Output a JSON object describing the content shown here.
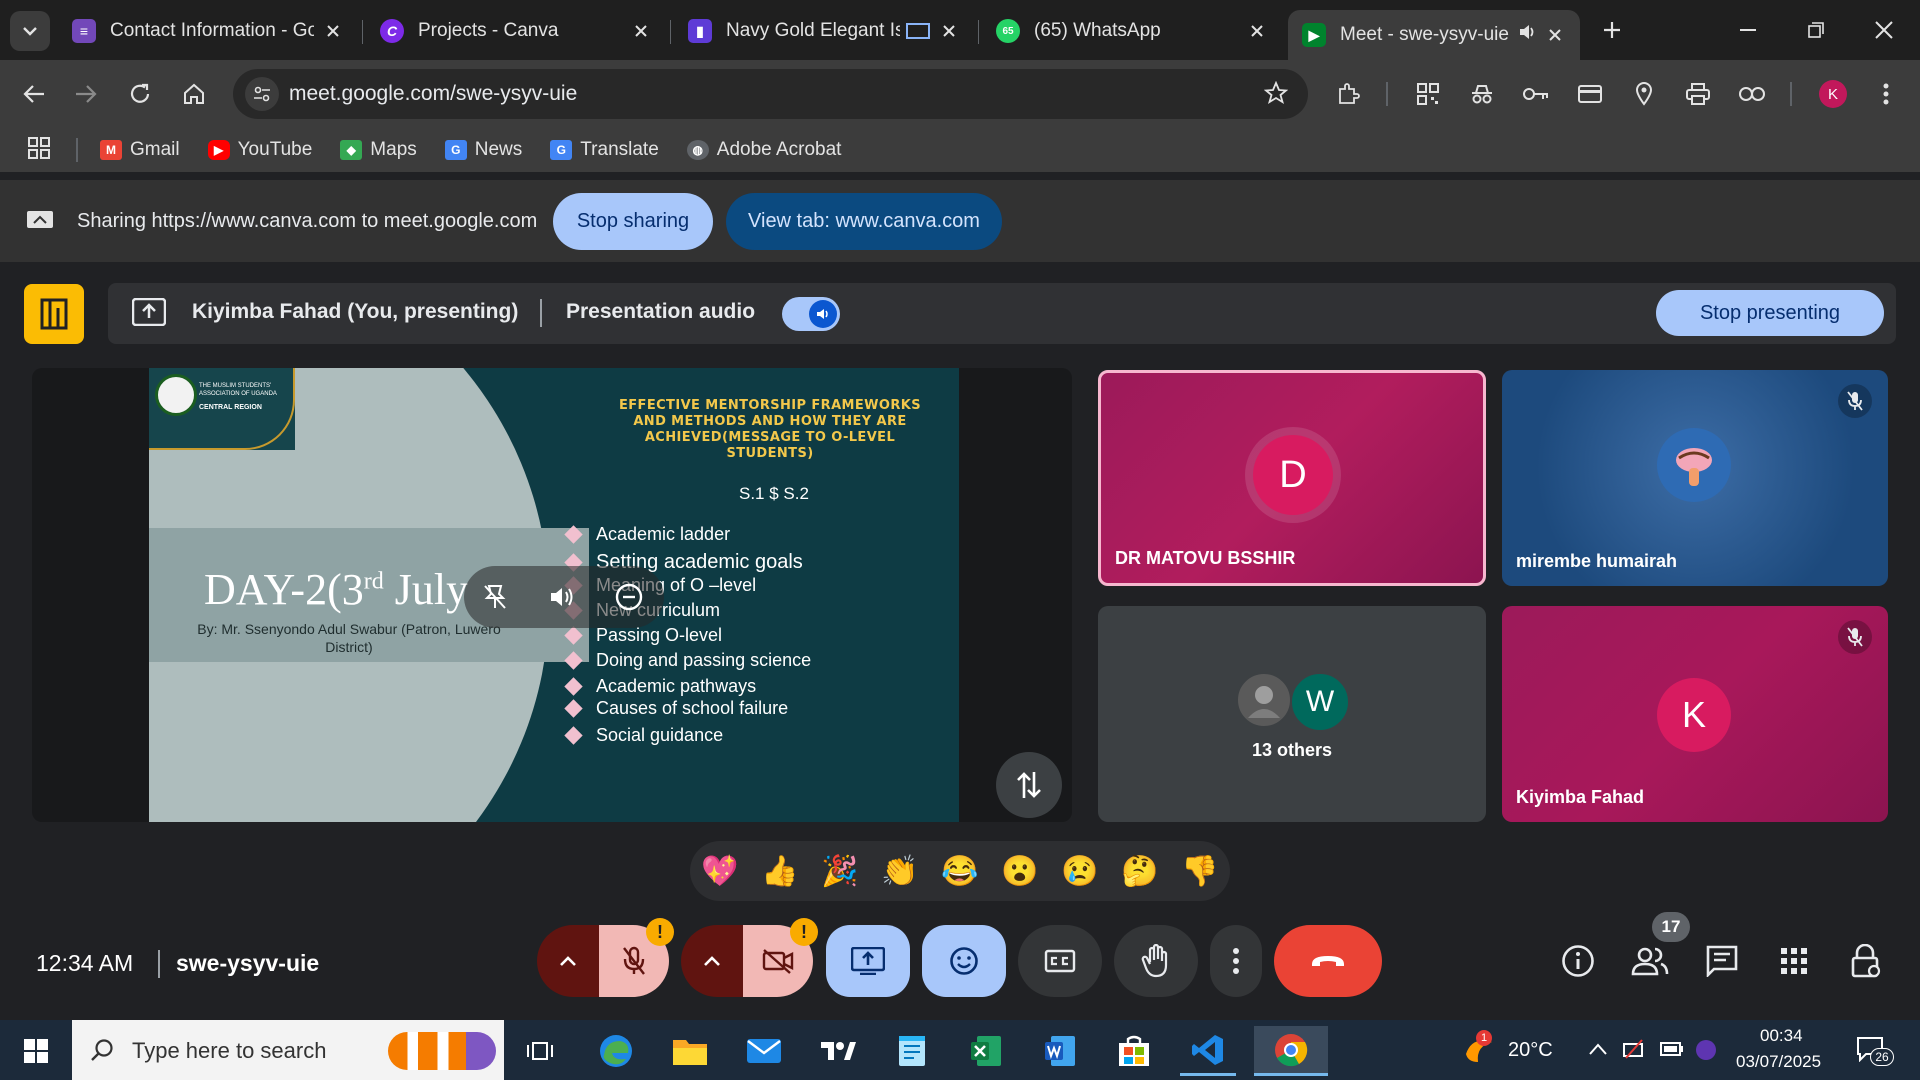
{
  "browser": {
    "tabs": [
      {
        "title": "Contact Information - Go",
        "icon": "google-forms-icon",
        "color": "#7248b9"
      },
      {
        "title": "Projects - Canva",
        "icon": "canva-icon",
        "color": "#7d2ae8"
      },
      {
        "title": "Navy Gold Elegant Isl",
        "icon": "canva-presentation-icon",
        "color": "#5e3bd6"
      },
      {
        "title": "(65) WhatsApp",
        "icon": "whatsapp-icon",
        "color": "#25d366",
        "badge": "65"
      },
      {
        "title": "Meet - swe-ysyv-uie",
        "icon": "google-meet-icon",
        "color": "#00832d",
        "active": true
      }
    ],
    "url": "meet.google.com/swe-ysyv-uie",
    "profile_initial": "K",
    "bookmarks": [
      {
        "label": "Gmail",
        "icon": "gmail-icon"
      },
      {
        "label": "YouTube",
        "icon": "youtube-icon"
      },
      {
        "label": "Maps",
        "icon": "maps-icon"
      },
      {
        "label": "News",
        "icon": "news-icon"
      },
      {
        "label": "Translate",
        "icon": "translate-icon"
      },
      {
        "label": "Adobe Acrobat",
        "icon": "globe-icon"
      }
    ]
  },
  "share_bar": {
    "text": "Sharing https://www.canva.com to meet.google.com",
    "stop_sharing": "Stop sharing",
    "view_tab": "View tab: www.canva.com"
  },
  "presenting_bar": {
    "presenter": "Kiyimba Fahad (You, presenting)",
    "audio_label": "Presentation audio",
    "stop_presenting": "Stop presenting"
  },
  "slide": {
    "logo_text": "THE MUSLIM STUDENTS' ASSOCIATION OF UGANDA",
    "logo_region": "CENTRAL REGION",
    "heading": "EFFECTIVE MENTORSHIP FRAMEWORKS AND METHODS AND HOW THEY ARE ACHIEVED(MESSAGE TO O-LEVEL STUDENTS)",
    "subheading": "S.1 $ S.2",
    "day_title": "DAY-2(3",
    "day_sup": "rd",
    "day_tail": " July",
    "by_line": "By: Mr. Ssenyondo Adul Swabur (Patron, Luwero District)",
    "bullets": [
      "Academic ladder",
      "Setting academic goals",
      "Meaning of O –level",
      "New curriculum",
      "Passing O-level",
      "Doing and passing science",
      "Academic pathways",
      "Causes of school failure",
      "Social guidance"
    ]
  },
  "participants": [
    {
      "name": "DR MATOVU BSSHIR",
      "initial": "D",
      "muted": false,
      "active": true
    },
    {
      "name": "mirembe humairah",
      "initial": "",
      "muted": true
    },
    {
      "name": "13 others",
      "initial": "W",
      "muted": false
    },
    {
      "name": "Kiyimba Fahad",
      "initial": "K",
      "muted": true
    }
  ],
  "reactions": [
    "💖",
    "👍",
    "🎉",
    "👏",
    "😂",
    "😮",
    "😢",
    "🤔",
    "👎"
  ],
  "meeting": {
    "time": "12:34 AM",
    "code": "swe-ysyv-uie",
    "people_count": "17",
    "warning_mark": "!"
  },
  "taskbar": {
    "search_placeholder": "Type here to search",
    "weather": "20°C",
    "weather_badge": "1",
    "clock_time": "00:34",
    "clock_date": "03/07/2025",
    "notification_count": "26"
  },
  "colors": {
    "accent_blue": "#a8c7fa",
    "hangup_red": "#ea4335",
    "participant_magenta": "#a3124f",
    "slide_teal": "#0e3b44"
  }
}
